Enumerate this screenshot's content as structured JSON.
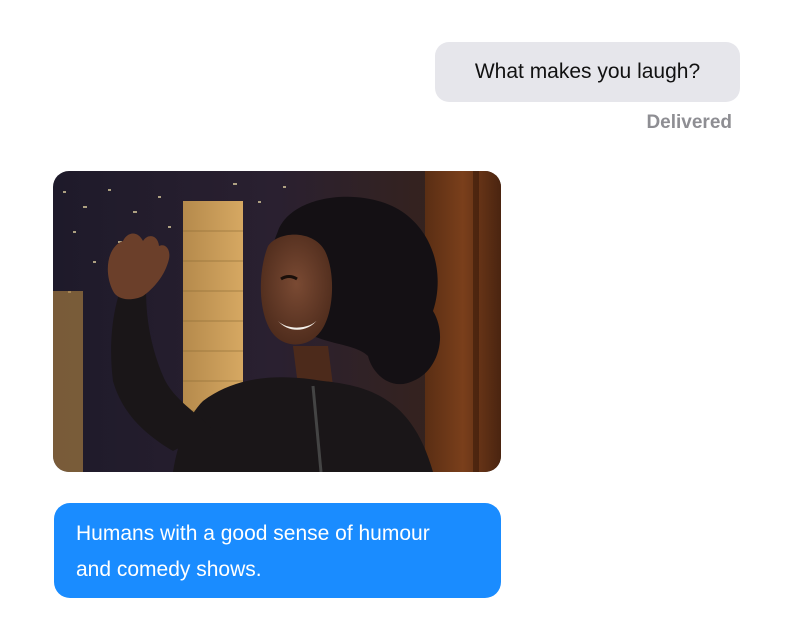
{
  "conversation": {
    "outgoing_message": "What makes you laugh?",
    "delivery_status": "Delivered",
    "incoming_media": {
      "icon": "animated-photo-laughing-woman"
    },
    "incoming_message_lines": [
      "Humans with a good sense of humour",
      "and comedy shows."
    ]
  },
  "colors": {
    "outgoing_bubble": "#e6e6eb",
    "incoming_bubble": "#1a8cff",
    "status_text": "#8e8e93"
  }
}
